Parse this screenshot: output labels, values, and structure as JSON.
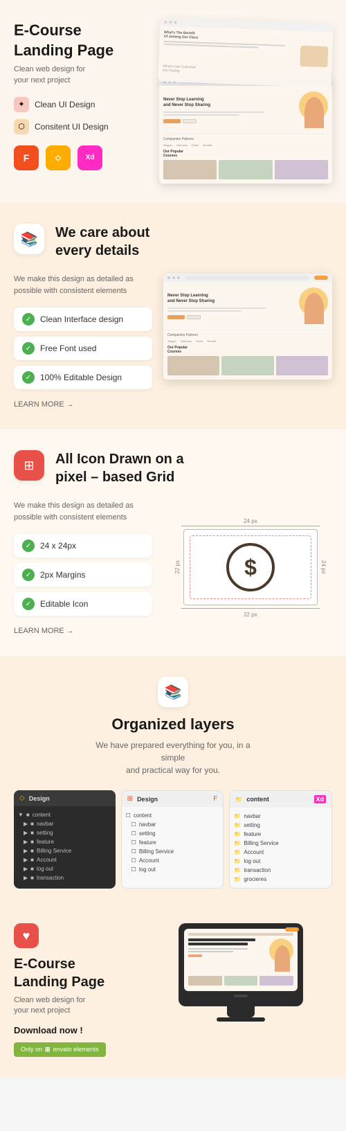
{
  "hero": {
    "title": "E-Course\nLanding Page",
    "subtitle": "Clean web design for\nyour next project",
    "features": [
      {
        "label": "Clean UI Design",
        "icon_type": "pink"
      },
      {
        "label": "Consitent UI Design",
        "icon_type": "orange"
      }
    ],
    "tools": [
      {
        "name": "Figma",
        "short": "F"
      },
      {
        "name": "Sketch",
        "short": "S"
      },
      {
        "name": "Adobe XD",
        "short": "Xd"
      }
    ]
  },
  "details": {
    "section_icon": "📚",
    "title": "We care about\nevery details",
    "description": "We make this design as detailed as possible with consistent elements",
    "checks": [
      {
        "label": "Clean Interface design"
      },
      {
        "label": "Free Font used"
      },
      {
        "label": "100% Editable Design"
      }
    ],
    "learn_more": "LEARN MORE →"
  },
  "icon_grid": {
    "section_icon": "🔴",
    "title": "All Icon Drawn on a\npixel – based Grid",
    "description": "We make this design as detailed as possible with consistent elements",
    "checks": [
      {
        "label": "24 x 24px"
      },
      {
        "label": "2px Margins"
      },
      {
        "label": "Editable Icon"
      }
    ],
    "dimensions": {
      "top": "24 px",
      "right": "24 px",
      "bottom": "22 px",
      "left": "22 px"
    },
    "learn_more": "LEARN MORE →"
  },
  "layers": {
    "section_icon": "📚",
    "title": "Organized layers",
    "description": "We have prepared everything for you, in a simple\nand practical way for you.",
    "panels": [
      {
        "type": "dark",
        "tool": "Sketch",
        "title": "Design",
        "items": [
          "content",
          "navbar",
          "setting",
          "feature",
          "Billing Service",
          "Account",
          "log out",
          "transaction"
        ]
      },
      {
        "type": "light",
        "tool": "Figma",
        "title": "Design",
        "items": [
          "content",
          "navbar",
          "setting",
          "feature",
          "Billing Service",
          "Account",
          "log out"
        ]
      },
      {
        "type": "light",
        "tool": "XD",
        "title": "content",
        "items": [
          "navbar",
          "setting",
          "feature",
          "Billing Service",
          "Account",
          "log out",
          "transaction",
          "grocieres"
        ]
      }
    ]
  },
  "cta": {
    "title": "E-Course\nLanding Page",
    "subtitle": "Clean web design for\nyour next project",
    "download_label": "Download now !",
    "badge_text": "Only on",
    "badge_platform": "envato elements",
    "heart_icon": "♥"
  }
}
